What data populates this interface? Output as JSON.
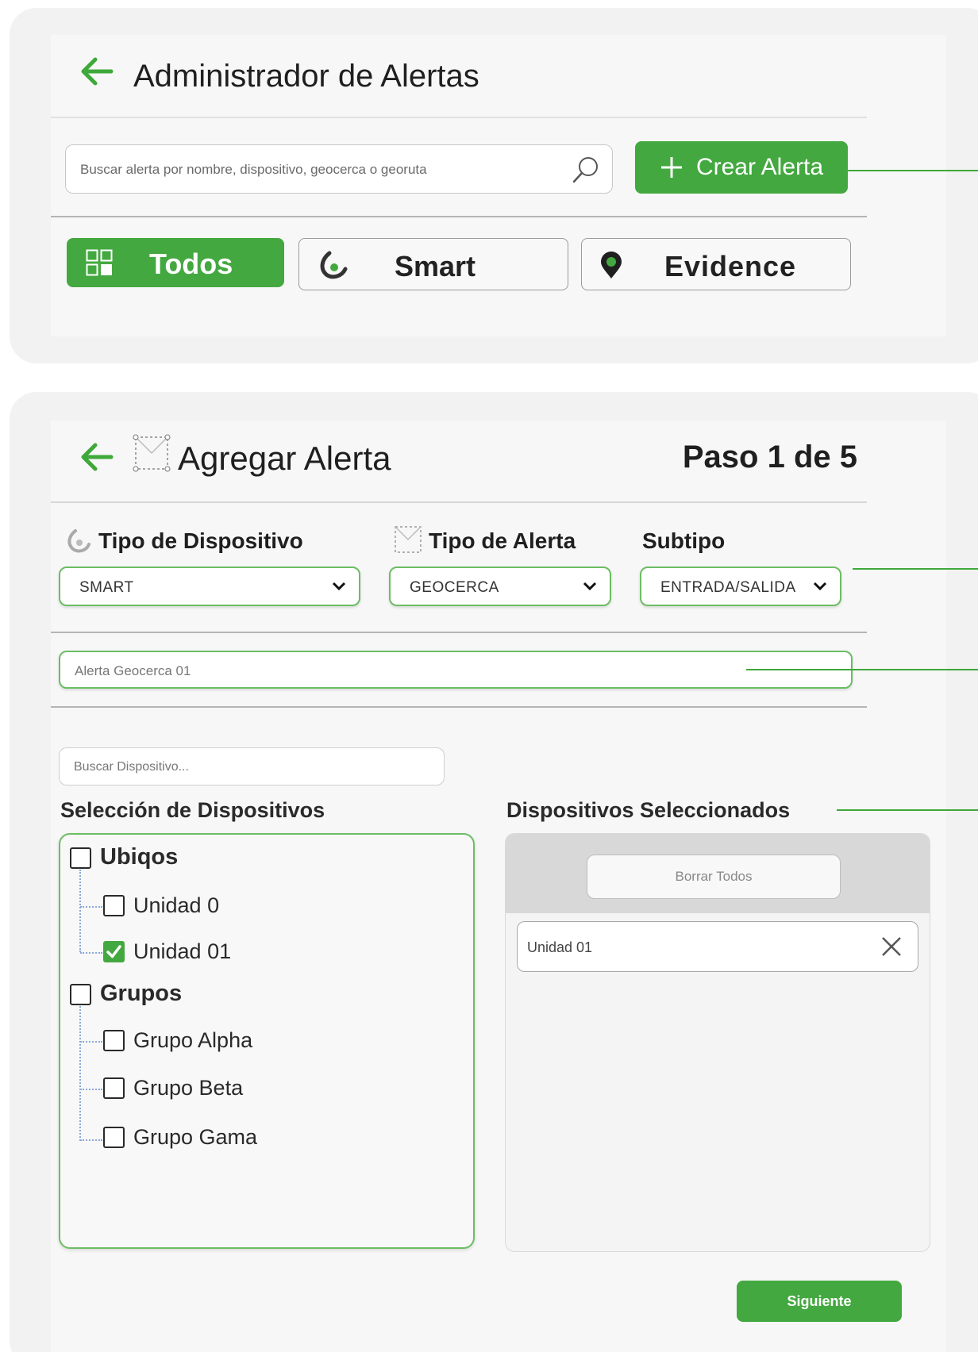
{
  "admin": {
    "title": "Administrador de Alertas",
    "search_placeholder": "Buscar alerta por nombre, dispositivo, geocerca o georuta",
    "create_button": "Crear Alerta",
    "create_icon": "plus-icon",
    "tabs": [
      {
        "label": "Todos",
        "icon": "grid-icon",
        "active": true
      },
      {
        "label": "Smart",
        "icon": "smart-logo-icon",
        "active": false
      },
      {
        "label": "Evidence",
        "icon": "location-pin-icon",
        "active": false
      }
    ]
  },
  "wizard": {
    "title": "Agregar Alerta",
    "step": "Paso 1 de 5",
    "device_type": {
      "label": "Tipo de Dispositivo",
      "value": "SMART"
    },
    "alert_type": {
      "label": "Tipo de Alerta",
      "value": "GEOCERCA"
    },
    "subtype": {
      "label": "Subtipo",
      "value": "ENTRADA/SALIDA"
    },
    "alert_name_value": "Alerta Geocerca 01",
    "device_search_placeholder": "Buscar Dispositivo...",
    "selection_title": "Selección de Dispositivos",
    "selected_title": "Dispositivos Seleccionados",
    "tree": [
      {
        "label": "Ubiqos",
        "checked": false,
        "children": [
          {
            "label": "Unidad 0",
            "checked": false
          },
          {
            "label": "Unidad 01",
            "checked": true
          }
        ]
      },
      {
        "label": "Grupos",
        "checked": false,
        "children": [
          {
            "label": "Grupo Alpha",
            "checked": false
          },
          {
            "label": "Grupo Beta",
            "checked": false
          },
          {
            "label": "Grupo Gama",
            "checked": false
          }
        ]
      }
    ],
    "clear_all_button": "Borrar Todos",
    "selected_items": [
      "Unidad 01"
    ],
    "next_button": "Siguiente"
  },
  "colors": {
    "accent": "#44a840",
    "panel_bg": "#f2f2f2",
    "border_green": "#6cbd64"
  }
}
